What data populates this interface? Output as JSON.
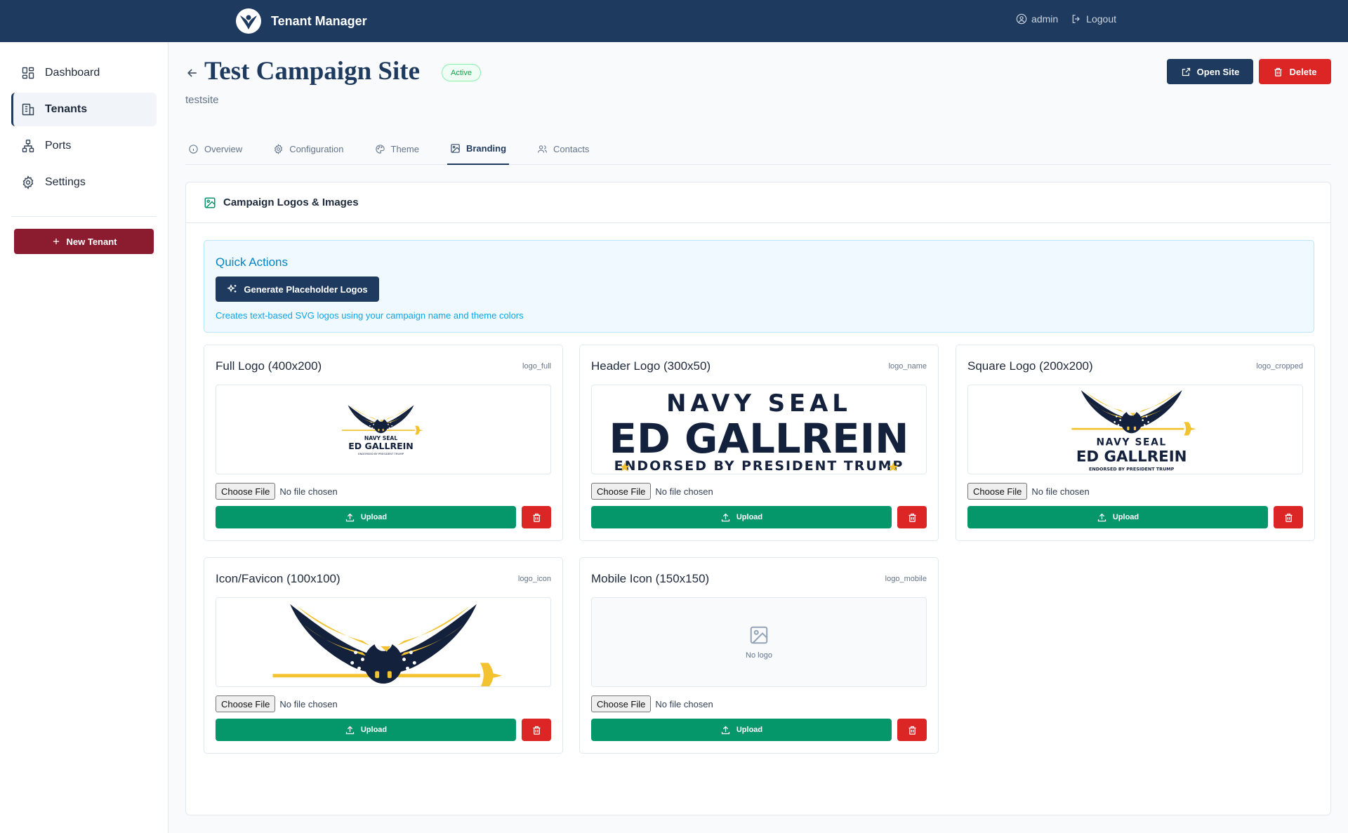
{
  "app": {
    "title": "Tenant Manager",
    "user": "admin",
    "logout": "Logout"
  },
  "sidebar": {
    "items": [
      {
        "label": "Dashboard",
        "icon": "dashboard-icon"
      },
      {
        "label": "Tenants",
        "icon": "building-icon",
        "active": true
      },
      {
        "label": "Ports",
        "icon": "network-icon"
      },
      {
        "label": "Settings",
        "icon": "gear-icon"
      }
    ],
    "new_tenant": "New Tenant"
  },
  "page": {
    "title": "Test Campaign Site",
    "status": "Active",
    "slug": "testsite",
    "open_site": "Open Site",
    "delete": "Delete"
  },
  "tabs": [
    {
      "label": "Overview",
      "icon": "info-icon"
    },
    {
      "label": "Configuration",
      "icon": "gear-icon"
    },
    {
      "label": "Theme",
      "icon": "palette-icon"
    },
    {
      "label": "Branding",
      "icon": "image-icon",
      "active": true
    },
    {
      "label": "Contacts",
      "icon": "users-icon"
    }
  ],
  "section": {
    "title": "Campaign Logos & Images"
  },
  "quick_actions": {
    "title": "Quick Actions",
    "button": "Generate Placeholder Logos",
    "description": "Creates text-based SVG logos using your campaign name and theme colors"
  },
  "logo_text": {
    "line1": "NAVY SEAL",
    "line2": "ED GALLREIN",
    "line3": "ENDORSED BY PRESIDENT TRUMP"
  },
  "logos": [
    {
      "title": "Full Logo (400x200)",
      "key": "logo_full",
      "file_label": "Choose File",
      "file_status": "No file chosen",
      "upload": "Upload"
    },
    {
      "title": "Header Logo (300x50)",
      "key": "logo_name",
      "file_label": "Choose File",
      "file_status": "No file chosen",
      "upload": "Upload"
    },
    {
      "title": "Square Logo (200x200)",
      "key": "logo_cropped",
      "file_label": "Choose File",
      "file_status": "No file chosen",
      "upload": "Upload"
    },
    {
      "title": "Icon/Favicon (100x100)",
      "key": "logo_icon",
      "file_label": "Choose File",
      "file_status": "No file chosen",
      "upload": "Upload"
    },
    {
      "title": "Mobile Icon (150x150)",
      "key": "logo_mobile",
      "file_label": "Choose File",
      "file_status": "No file chosen",
      "upload": "Upload",
      "empty_label": "No logo"
    }
  ],
  "colors": {
    "navy": "#1e3a5f",
    "brand_navy": "#14213d",
    "gold": "#f2c230",
    "green": "#059669",
    "red": "#dc2626",
    "maroon": "#8b1c2f"
  }
}
